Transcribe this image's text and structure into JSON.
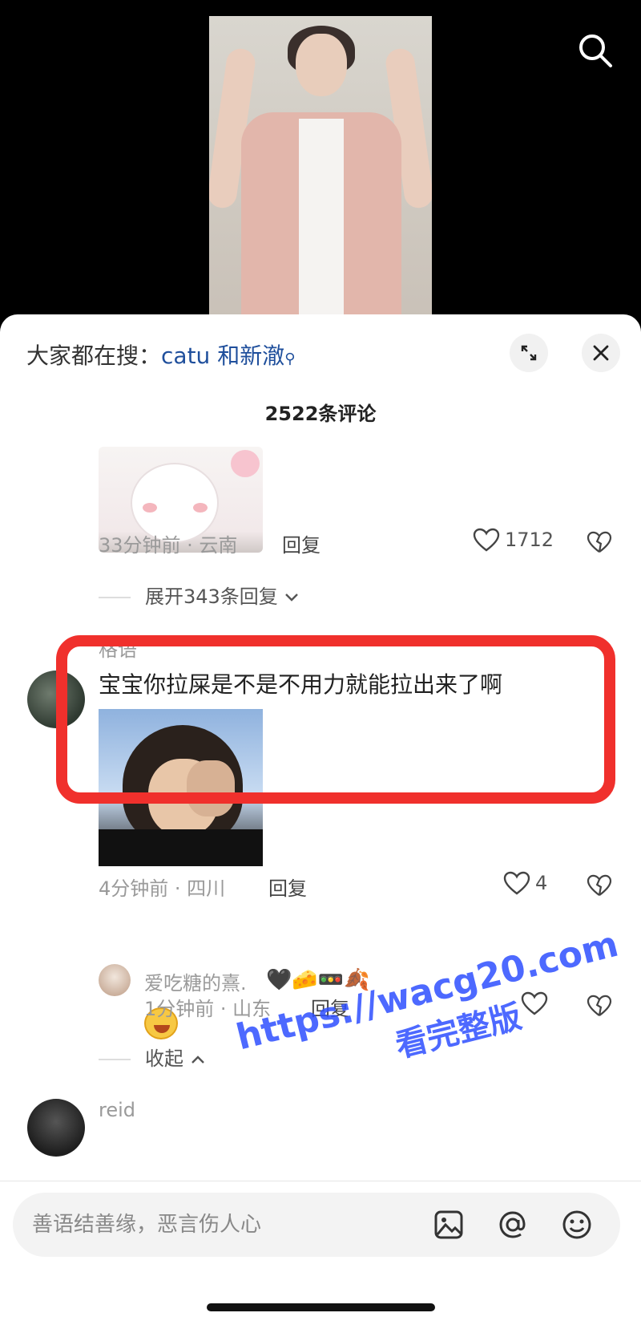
{
  "trending": {
    "prefix": "大家都在搜：",
    "keyword": "catu 和新澈"
  },
  "comments_count": "2522条评论",
  "comment1": {
    "time_location": "33分钟前 · 云南",
    "reply": "回复",
    "likes": "1712",
    "expand_replies": "展开343条回复"
  },
  "comment2": {
    "username": "格语",
    "text": "宝宝你拉屎是不是不用力就能拉出来了啊",
    "time_location": "4分钟前 · 四川",
    "reply": "回复",
    "likes": "4"
  },
  "reply1": {
    "username": "爱吃糖的熹.",
    "emojis": "🖤🧀🚥🍂",
    "time_location": "1分钟前 · 山东",
    "reply": "回复"
  },
  "collapse": "收起",
  "comment3": {
    "username": "reid"
  },
  "input": {
    "placeholder": "善语结善缘，恶言伤人心"
  },
  "watermark": {
    "url": "https://wacg20.com",
    "tag": "看完整版"
  },
  "colors": {
    "accent_link": "#1f4f9c",
    "highlight": "#f0302c",
    "watermark": "#2f4fff"
  },
  "icons": [
    "search-icon",
    "expand-icon",
    "close-icon",
    "heart-icon",
    "broken-heart-icon",
    "chevron-down-icon",
    "chevron-up-icon",
    "image-icon",
    "at-icon",
    "emoji-icon"
  ]
}
